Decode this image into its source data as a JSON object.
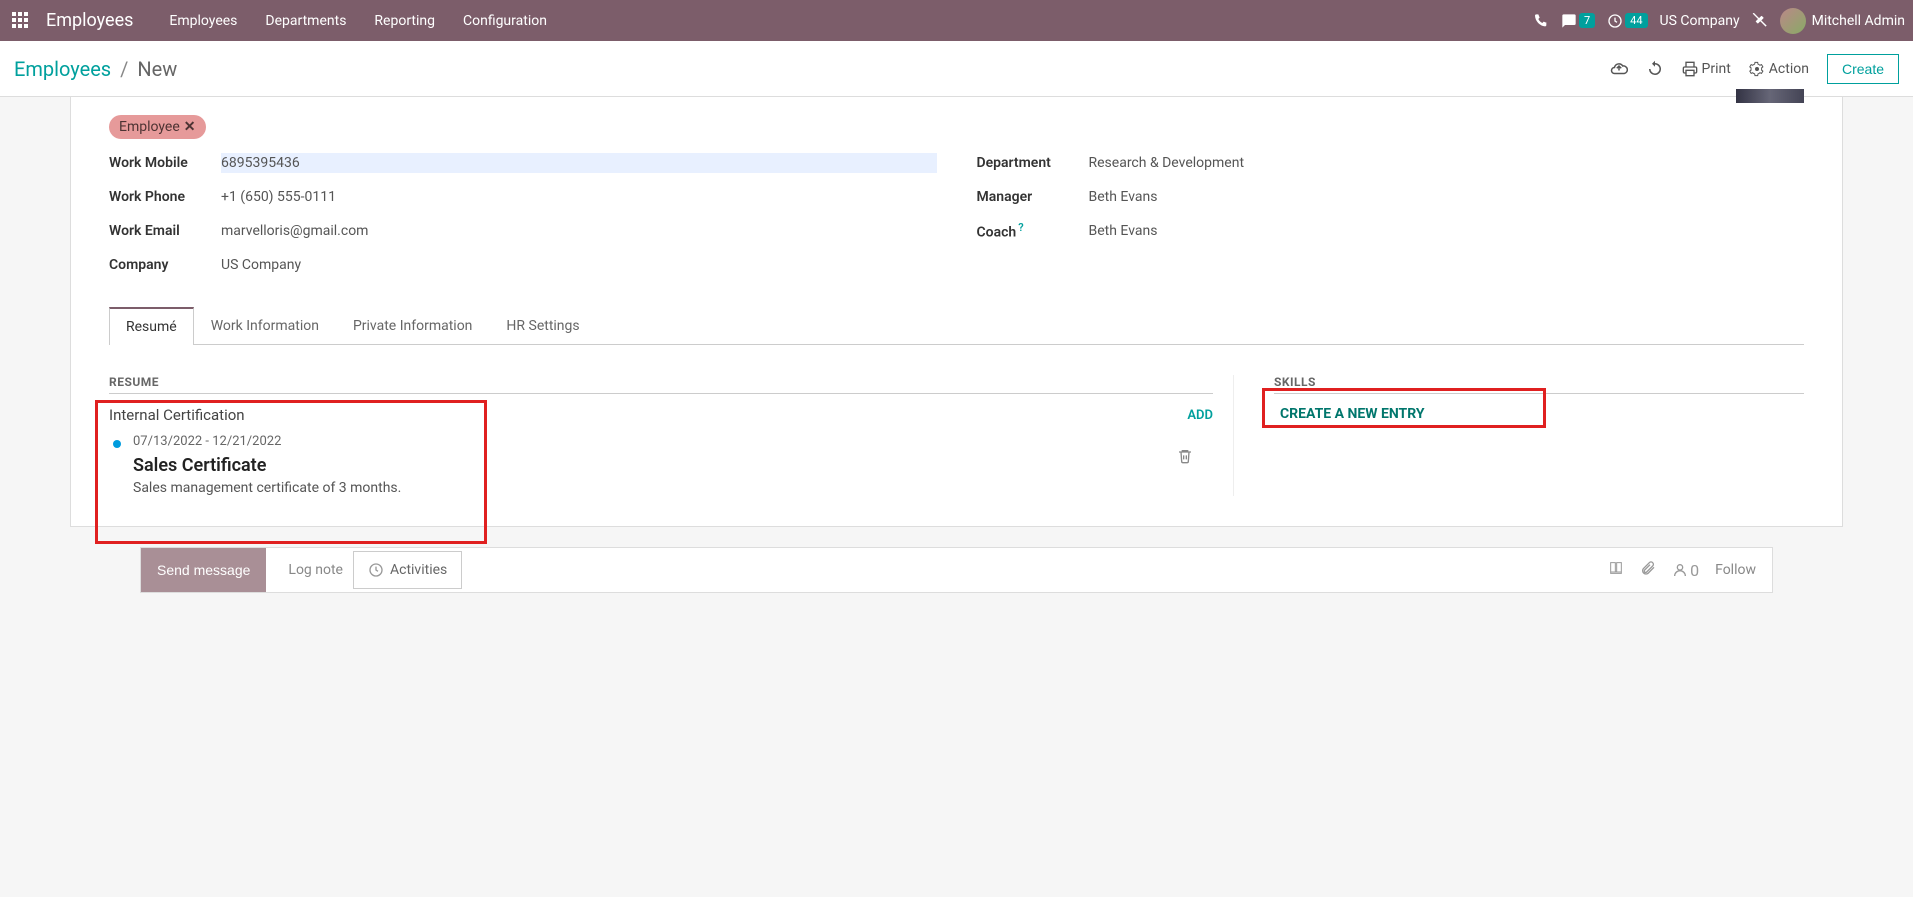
{
  "topbar": {
    "app_title": "Employees",
    "menu": [
      "Employees",
      "Departments",
      "Reporting",
      "Configuration"
    ],
    "msg_badge": "7",
    "clock_badge": "44",
    "company": "US Company",
    "user": "Mitchell Admin"
  },
  "breadcrumb": {
    "root": "Employees",
    "current": "New"
  },
  "actions": {
    "print": "Print",
    "action": "Action",
    "create": "Create"
  },
  "tag": {
    "label": "Employee"
  },
  "form": {
    "left": {
      "work_mobile_label": "Work Mobile",
      "work_mobile": "6895395436",
      "work_phone_label": "Work Phone",
      "work_phone": "+1 (650) 555-0111",
      "work_email_label": "Work Email",
      "work_email": "marvelloris@gmail.com",
      "company_label": "Company",
      "company": "US Company"
    },
    "right": {
      "department_label": "Department",
      "department": "Research & Development",
      "manager_label": "Manager",
      "manager": "Beth Evans",
      "coach_label": "Coach",
      "coach": "Beth Evans"
    }
  },
  "tabs": [
    "Resumé",
    "Work Information",
    "Private Information",
    "HR Settings"
  ],
  "resume": {
    "section": "RESUME",
    "type": "Internal Certification",
    "add": "ADD",
    "dates": "07/13/2022 - 12/21/2022",
    "title": "Sales Certificate",
    "desc": "Sales management certificate of 3 months."
  },
  "skills": {
    "section": "SKILLS",
    "create": "CREATE A NEW ENTRY"
  },
  "chatter": {
    "send": "Send message",
    "log": "Log note",
    "activities": "Activities",
    "followers": "0",
    "follow": "Follow"
  }
}
